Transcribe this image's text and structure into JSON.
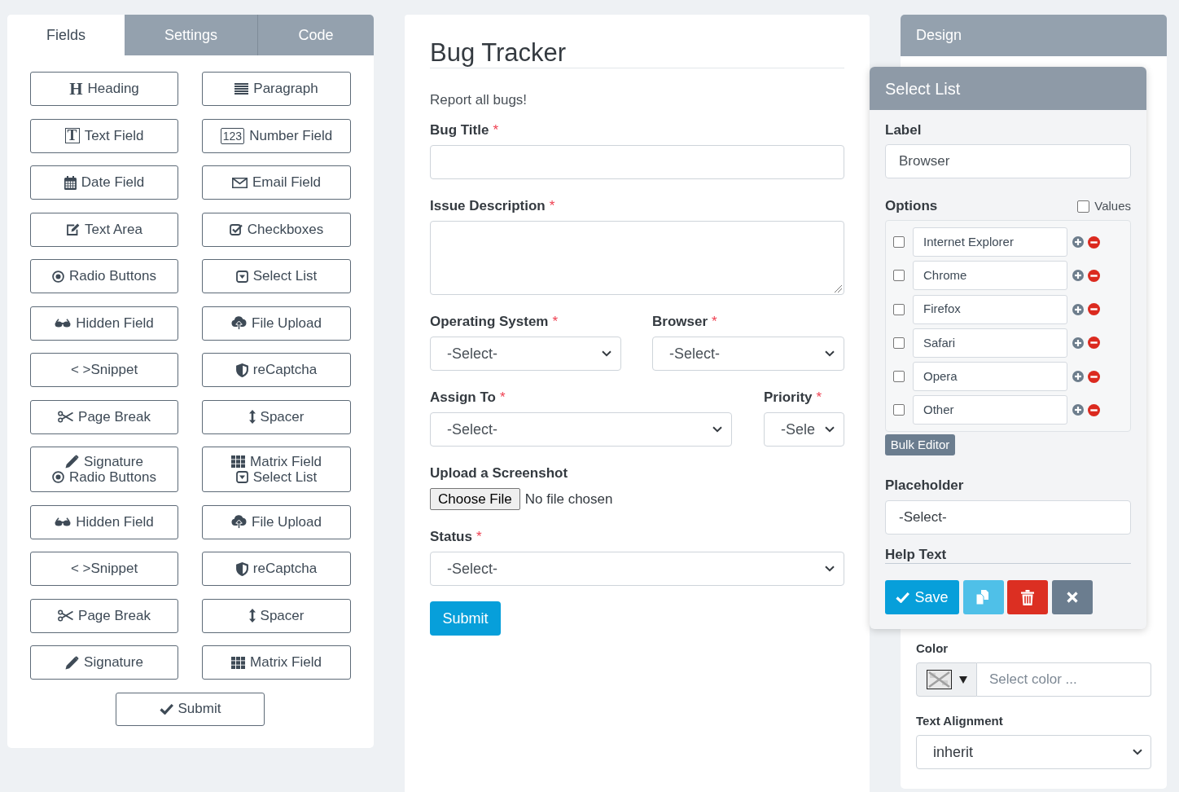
{
  "builder_tabs": [
    {
      "label": "Fields",
      "selected": true
    },
    {
      "label": "Settings",
      "selected": false
    },
    {
      "label": "Code",
      "selected": false
    }
  ],
  "field_buttons": [
    {
      "kind": "heading",
      "label": "Heading",
      "icon_text": "H"
    },
    {
      "kind": "paragraph",
      "label": "Paragraph"
    },
    {
      "kind": "text",
      "label": "Text Field",
      "icon_text": "T"
    },
    {
      "kind": "number",
      "label": "Number Field",
      "icon_text": "123"
    },
    {
      "kind": "date",
      "label": "Date Field"
    },
    {
      "kind": "email",
      "label": "Email Field"
    },
    {
      "kind": "textarea",
      "label": "Text Area"
    },
    {
      "kind": "checkboxes",
      "label": "Checkboxes"
    },
    {
      "kind": "radio",
      "label": "Radio Buttons"
    },
    {
      "kind": "select",
      "label": "Select List"
    },
    {
      "kind": "hidden",
      "label": "Hidden Field"
    },
    {
      "kind": "file",
      "label": "File Upload"
    },
    {
      "kind": "snippet",
      "label": "< >Snippet"
    },
    {
      "kind": "recaptcha",
      "label": "reCaptcha"
    },
    {
      "kind": "pagebreak",
      "label": "Page Break"
    },
    {
      "kind": "spacer",
      "label": "Spacer"
    },
    {
      "kind": "signature",
      "label": "Signature",
      "behind": {
        "kind": "radio",
        "label": "Radio Buttons"
      }
    },
    {
      "kind": "matrix",
      "label": "Matrix Field",
      "behind": {
        "kind": "select",
        "label": "Select List"
      }
    },
    {
      "kind": "hidden",
      "label": "Hidden Field"
    },
    {
      "kind": "file",
      "label": "File Upload"
    },
    {
      "kind": "snippet",
      "label": "< >Snippet"
    },
    {
      "kind": "recaptcha",
      "label": "reCaptcha"
    },
    {
      "kind": "pagebreak",
      "label": "Page Break"
    },
    {
      "kind": "spacer",
      "label": "Spacer"
    },
    {
      "kind": "signature",
      "label": "Signature"
    },
    {
      "kind": "matrix",
      "label": "Matrix Field"
    }
  ],
  "submit_field_button": {
    "label": "Submit"
  },
  "form": {
    "title": "Bug Tracker",
    "description": "Report all bugs!",
    "rows": [
      [
        {
          "kind": "text",
          "label": "Bug Title",
          "required_mark": "*"
        }
      ],
      [
        {
          "kind": "textarea",
          "label": "Issue Description",
          "required_mark": "*"
        }
      ],
      [
        {
          "kind": "select",
          "label": "Operating System",
          "required_mark": "*",
          "value": "-Select-"
        },
        {
          "kind": "select",
          "label": "Browser",
          "required_mark": "*",
          "value": "-Select-"
        }
      ],
      [
        {
          "kind": "select",
          "label": "Assign To",
          "required_mark": "*",
          "value": "-Select-"
        },
        {
          "kind": "select",
          "label": "Priority",
          "required_mark": "*",
          "value": "-Sele"
        }
      ],
      [
        {
          "kind": "file",
          "label": "Upload a Screenshot",
          "button": "Choose File",
          "status": "No file chosen"
        }
      ],
      [
        {
          "kind": "select",
          "label": "Status",
          "required_mark": "*",
          "value": "-Select-"
        }
      ]
    ],
    "submit": "Submit"
  },
  "select_list_editor": {
    "title": "Select List",
    "label_caption": "Label",
    "label_value": "Browser",
    "options_caption": "Options",
    "values_toggle": {
      "label": "Values",
      "checked": false
    },
    "options": [
      {
        "label": "Internet Explorer",
        "checked": false
      },
      {
        "label": "Chrome",
        "checked": false
      },
      {
        "label": "Firefox",
        "checked": false
      },
      {
        "label": "Safari",
        "checked": false
      },
      {
        "label": "Opera",
        "checked": false
      },
      {
        "label": "Other",
        "checked": false
      }
    ],
    "bulk_editor": "Bulk Editor",
    "placeholder_caption": "Placeholder",
    "placeholder_value": "-Select-",
    "help_text_caption": "Help Text",
    "save": "Save"
  },
  "design_panel": {
    "title": "Design",
    "color_caption": "Color",
    "color_placeholder": "Select color ...",
    "alignment_caption": "Text Alignment",
    "alignment_value": "inherit"
  }
}
